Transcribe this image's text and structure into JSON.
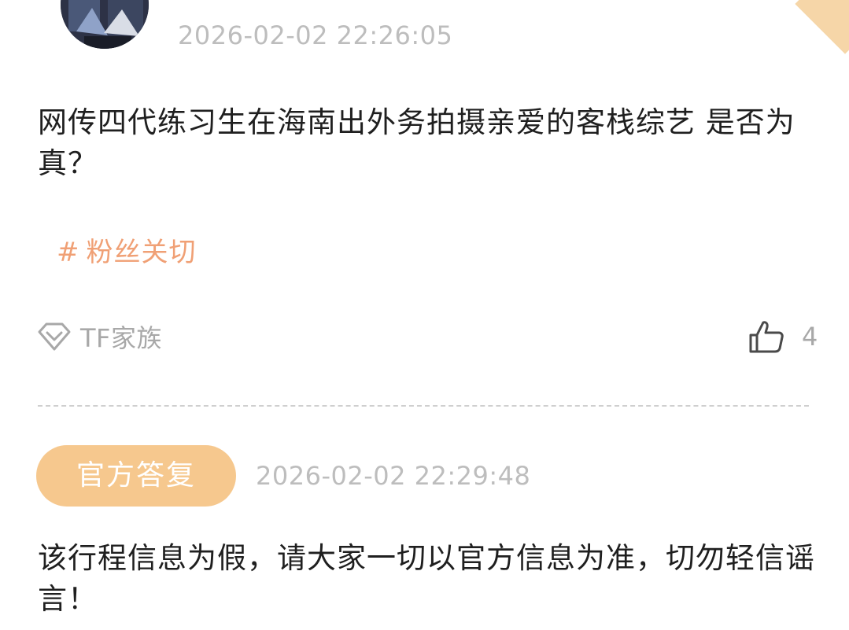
{
  "post": {
    "timestamp": "2026-02-02 22:26:05",
    "question": "网传四代练习生在海南出外务拍摄亲爱的客栈综艺 是否为真？",
    "topic_hash": "#",
    "topic": "粉丝关切",
    "group_icon": "diamond-icon",
    "group_name": "TF家族",
    "like_icon": "thumbs-up-icon",
    "like_count": "4"
  },
  "reply": {
    "badge_label": "官方答复",
    "timestamp": "2026-02-02 22:29:48",
    "text": "该行程信息为假，请大家一切以官方信息为准，切勿轻信谣言！"
  },
  "colors": {
    "badge_bg": "#f6c88e",
    "topic_color": "#f0a075",
    "meta_gray": "#bdbdbd",
    "corner_accent": "#f6d6a8"
  }
}
